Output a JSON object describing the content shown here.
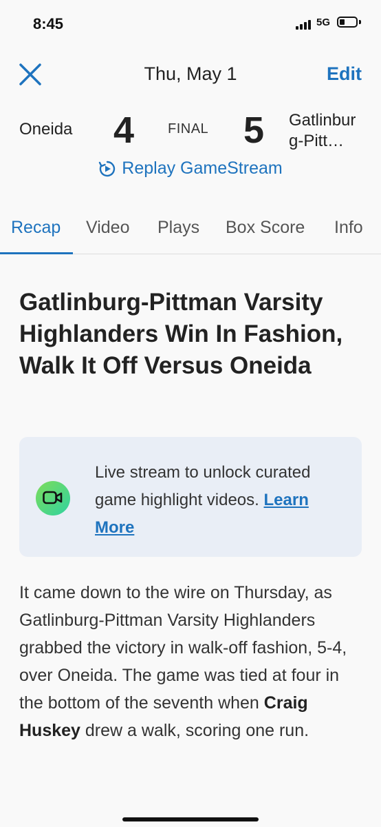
{
  "status_bar": {
    "time": "8:45",
    "network": "5G"
  },
  "header": {
    "title": "Thu, May 1",
    "edit_label": "Edit"
  },
  "scoreboard": {
    "away_team": "Oneida",
    "away_score": "4",
    "status": "FINAL",
    "home_score": "5",
    "home_team": "Gatlinburg-Pitt…"
  },
  "replay": {
    "label": "Replay GameStream"
  },
  "tabs": [
    {
      "label": "Recap"
    },
    {
      "label": "Video"
    },
    {
      "label": "Plays"
    },
    {
      "label": "Box Score"
    },
    {
      "label": "Info"
    }
  ],
  "article": {
    "headline": "Gatlinburg-Pittman Varsity Highlanders Win In Fashion, Walk It Off Versus Oneida",
    "promo": {
      "text": "Live stream to unlock curated game highlight videos.",
      "link": "Learn More"
    },
    "body_part1": "It came down to the wire on Thursday, as Gatlinburg-Pittman Varsity Highlanders grabbed the victory in walk-off fashion, 5-4, over Oneida. The game was tied at four in the bottom of the seventh when",
    "player_name": "Craig Huskey",
    "body_part2": "drew a walk, scoring one run."
  },
  "colors": {
    "accent": "#1e73be",
    "promo_bg": "#e9eef6"
  }
}
